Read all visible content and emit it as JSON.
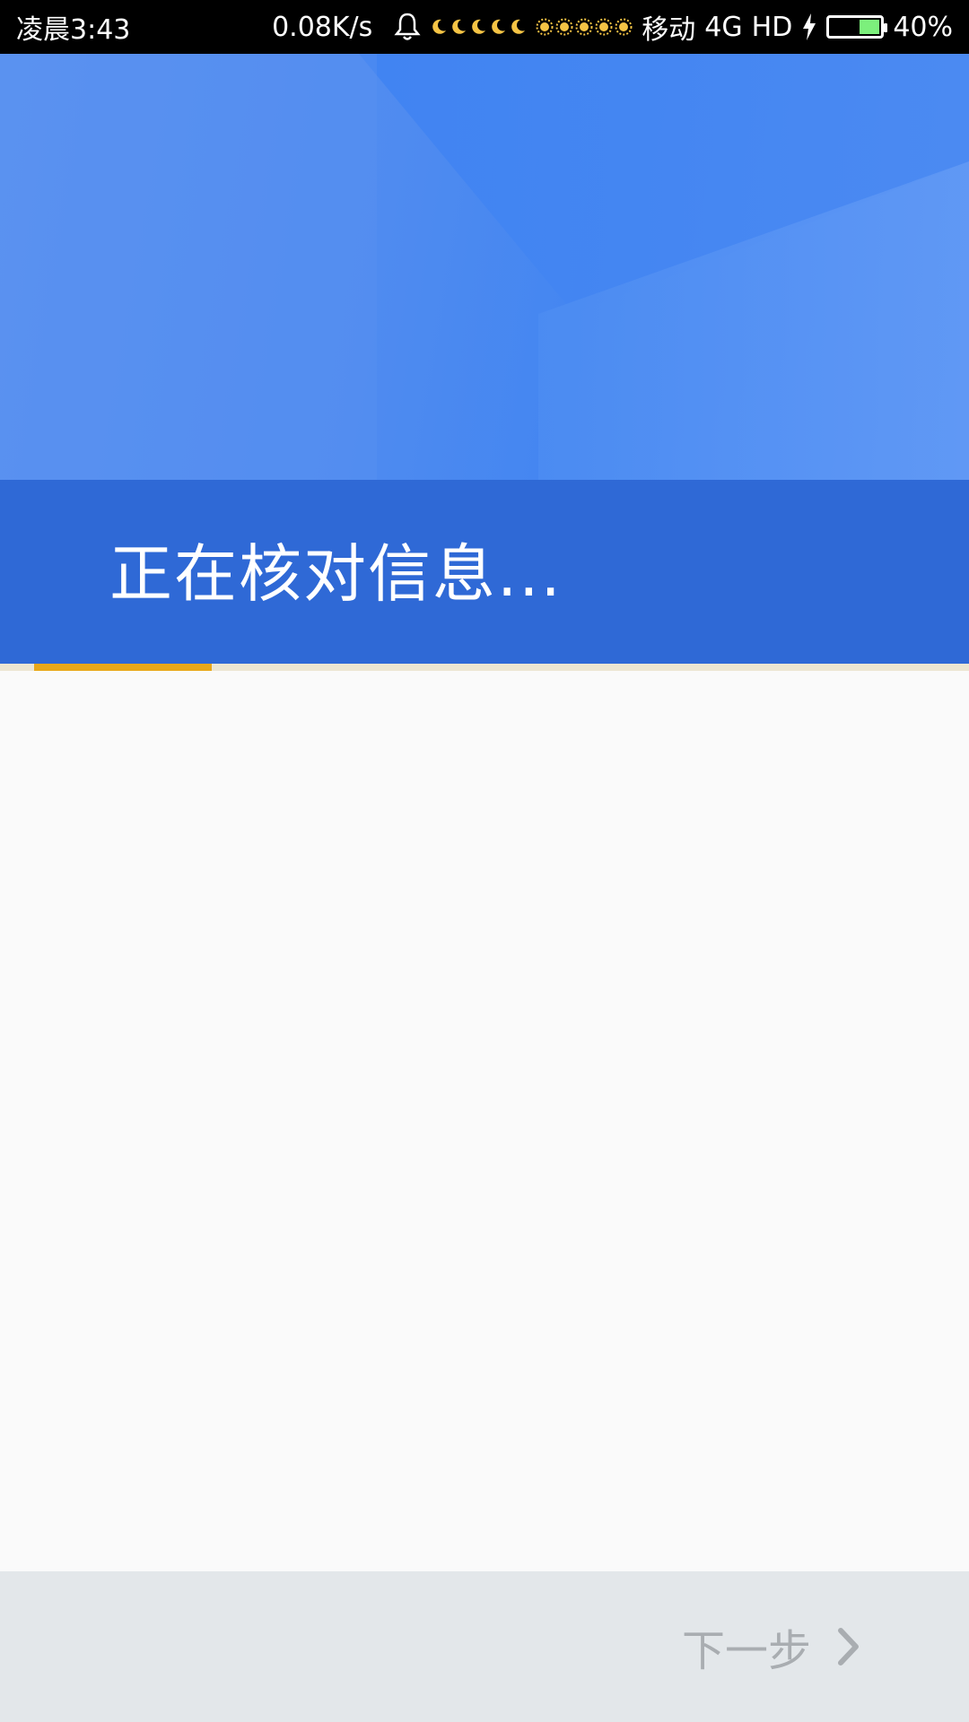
{
  "status_bar": {
    "time": "凌晨3:43",
    "net_speed": "0.08K/s",
    "carrier": "移动",
    "network": "4G",
    "hd": "HD",
    "battery_percent": "40%",
    "battery_level": 0.4,
    "icons": [
      "bell-icon",
      "moon-icon",
      "sun-icon",
      "bolt-icon",
      "battery-icon"
    ]
  },
  "header": {
    "title": "正在核对信息..."
  },
  "progress": {
    "value": 0.19,
    "color": "#e9a81a"
  },
  "footer": {
    "next_label": "下一步"
  },
  "colors": {
    "hero_blue": "#4f8bf0",
    "band_blue": "#2f69d6",
    "footer_bg": "#e3e7ea",
    "next_text": "#a9adb1"
  }
}
